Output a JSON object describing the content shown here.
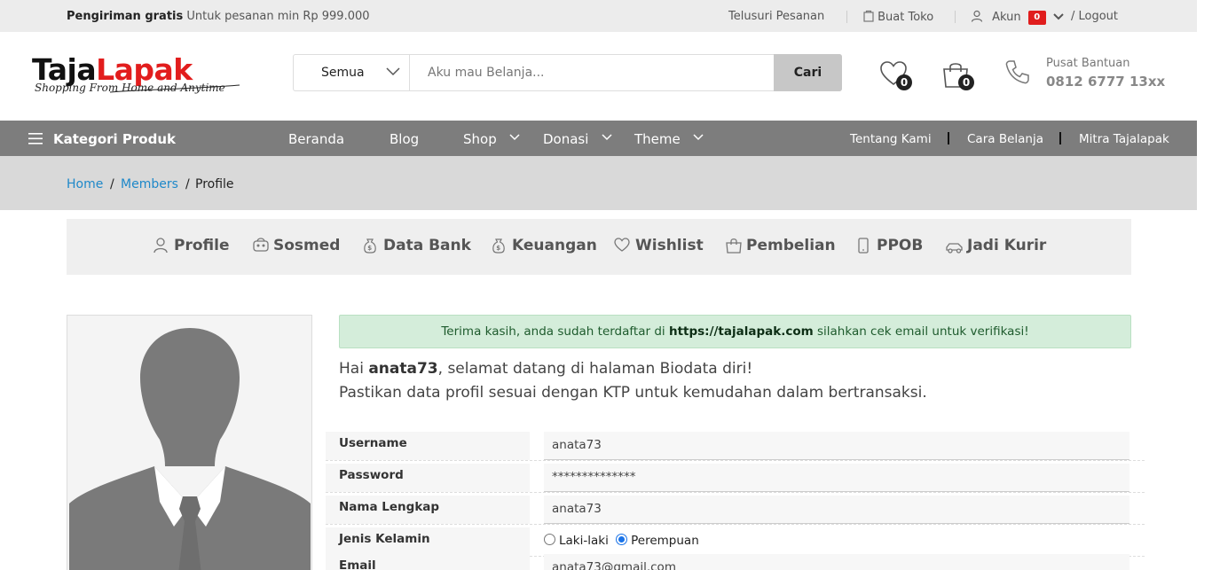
{
  "topbar": {
    "promo_bold": "Pengiriman gratis",
    "promo_text": "Untuk pesanan min Rp 999.000",
    "track_order": "Telusuri Pesanan",
    "open_store": "Buat Toko",
    "account": "Akun",
    "account_badge": "0",
    "logout": "/ Logout"
  },
  "header": {
    "logo_part1": "Taja",
    "logo_part2": "Lapak",
    "logo_tagline": "Shopping From Home and Anytime",
    "search_category": "Semua",
    "search_placeholder": "Aku mau Belanja...",
    "search_button": "Cari",
    "wishlist_count": "0",
    "cart_count": "0",
    "help_label": "Pusat Bantuan",
    "help_phone": "0812 6777 13xx"
  },
  "nav": {
    "categories": "Kategori Produk",
    "items": [
      "Beranda",
      "Blog",
      "Shop",
      "Donasi",
      "Theme"
    ],
    "right_links": [
      "Tentang Kami",
      "Cara Belanja",
      "Mitra Tajalapak"
    ]
  },
  "breadcrumb": {
    "home": "Home",
    "members": "Members",
    "current": "Profile",
    "sep": "/"
  },
  "member_tabs": [
    "Profile",
    "Sosmed",
    "Data Bank",
    "Keuangan",
    "Wishlist",
    "Pembelian",
    "PPOB",
    "Jadi Kurir"
  ],
  "alert": {
    "before": "Terima kasih, anda sudah terdaftar di ",
    "link": "https://tajalapak.com",
    "after": " silahkan cek email untuk verifikasi!"
  },
  "welcome": {
    "hi": "Hai ",
    "username": "anata73",
    "line1_rest": ", selamat datang di halaman Biodata diri!",
    "line2": "Pastikan data profil sesuai dengan KTP untuk kemudahan dalam bertransaksi."
  },
  "profile_form": {
    "username_label": "Username",
    "username_value": "anata73",
    "password_label": "Password",
    "password_value": "**************",
    "fullname_label": "Nama Lengkap",
    "fullname_value": "anata73",
    "gender_label": "Jenis Kelamin",
    "gender_male": "Laki-laki",
    "gender_female": "Perempuan",
    "gender_selected": "Perempuan",
    "email_label": "Email",
    "email_value": "anata73@gmail.com"
  },
  "colors": {
    "accent_red": "#e21d1d",
    "nav_gray": "#7d7d7d",
    "link_blue": "#1e88c9",
    "alert_green": "#d4edda"
  }
}
